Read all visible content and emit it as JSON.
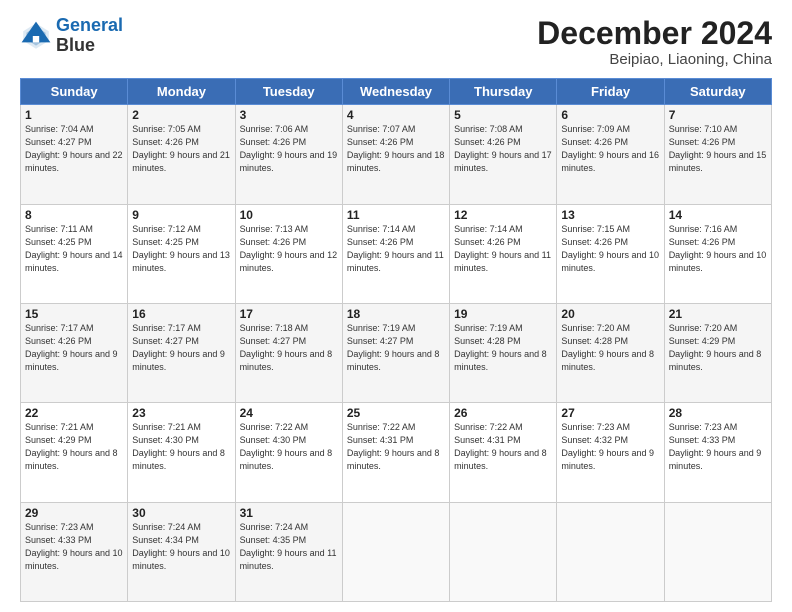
{
  "header": {
    "logo_line1": "General",
    "logo_line2": "Blue",
    "title": "December 2024",
    "subtitle": "Beipiao, Liaoning, China"
  },
  "weekdays": [
    "Sunday",
    "Monday",
    "Tuesday",
    "Wednesday",
    "Thursday",
    "Friday",
    "Saturday"
  ],
  "weeks": [
    [
      {
        "day": "1",
        "sunrise": "7:04 AM",
        "sunset": "4:27 PM",
        "daylight": "9 hours and 22 minutes."
      },
      {
        "day": "2",
        "sunrise": "7:05 AM",
        "sunset": "4:26 PM",
        "daylight": "9 hours and 21 minutes."
      },
      {
        "day": "3",
        "sunrise": "7:06 AM",
        "sunset": "4:26 PM",
        "daylight": "9 hours and 19 minutes."
      },
      {
        "day": "4",
        "sunrise": "7:07 AM",
        "sunset": "4:26 PM",
        "daylight": "9 hours and 18 minutes."
      },
      {
        "day": "5",
        "sunrise": "7:08 AM",
        "sunset": "4:26 PM",
        "daylight": "9 hours and 17 minutes."
      },
      {
        "day": "6",
        "sunrise": "7:09 AM",
        "sunset": "4:26 PM",
        "daylight": "9 hours and 16 minutes."
      },
      {
        "day": "7",
        "sunrise": "7:10 AM",
        "sunset": "4:26 PM",
        "daylight": "9 hours and 15 minutes."
      }
    ],
    [
      {
        "day": "8",
        "sunrise": "7:11 AM",
        "sunset": "4:25 PM",
        "daylight": "9 hours and 14 minutes."
      },
      {
        "day": "9",
        "sunrise": "7:12 AM",
        "sunset": "4:25 PM",
        "daylight": "9 hours and 13 minutes."
      },
      {
        "day": "10",
        "sunrise": "7:13 AM",
        "sunset": "4:26 PM",
        "daylight": "9 hours and 12 minutes."
      },
      {
        "day": "11",
        "sunrise": "7:14 AM",
        "sunset": "4:26 PM",
        "daylight": "9 hours and 11 minutes."
      },
      {
        "day": "12",
        "sunrise": "7:14 AM",
        "sunset": "4:26 PM",
        "daylight": "9 hours and 11 minutes."
      },
      {
        "day": "13",
        "sunrise": "7:15 AM",
        "sunset": "4:26 PM",
        "daylight": "9 hours and 10 minutes."
      },
      {
        "day": "14",
        "sunrise": "7:16 AM",
        "sunset": "4:26 PM",
        "daylight": "9 hours and 10 minutes."
      }
    ],
    [
      {
        "day": "15",
        "sunrise": "7:17 AM",
        "sunset": "4:26 PM",
        "daylight": "9 hours and 9 minutes."
      },
      {
        "day": "16",
        "sunrise": "7:17 AM",
        "sunset": "4:27 PM",
        "daylight": "9 hours and 9 minutes."
      },
      {
        "day": "17",
        "sunrise": "7:18 AM",
        "sunset": "4:27 PM",
        "daylight": "9 hours and 8 minutes."
      },
      {
        "day": "18",
        "sunrise": "7:19 AM",
        "sunset": "4:27 PM",
        "daylight": "9 hours and 8 minutes."
      },
      {
        "day": "19",
        "sunrise": "7:19 AM",
        "sunset": "4:28 PM",
        "daylight": "9 hours and 8 minutes."
      },
      {
        "day": "20",
        "sunrise": "7:20 AM",
        "sunset": "4:28 PM",
        "daylight": "9 hours and 8 minutes."
      },
      {
        "day": "21",
        "sunrise": "7:20 AM",
        "sunset": "4:29 PM",
        "daylight": "9 hours and 8 minutes."
      }
    ],
    [
      {
        "day": "22",
        "sunrise": "7:21 AM",
        "sunset": "4:29 PM",
        "daylight": "9 hours and 8 minutes."
      },
      {
        "day": "23",
        "sunrise": "7:21 AM",
        "sunset": "4:30 PM",
        "daylight": "9 hours and 8 minutes."
      },
      {
        "day": "24",
        "sunrise": "7:22 AM",
        "sunset": "4:30 PM",
        "daylight": "9 hours and 8 minutes."
      },
      {
        "day": "25",
        "sunrise": "7:22 AM",
        "sunset": "4:31 PM",
        "daylight": "9 hours and 8 minutes."
      },
      {
        "day": "26",
        "sunrise": "7:22 AM",
        "sunset": "4:31 PM",
        "daylight": "9 hours and 8 minutes."
      },
      {
        "day": "27",
        "sunrise": "7:23 AM",
        "sunset": "4:32 PM",
        "daylight": "9 hours and 9 minutes."
      },
      {
        "day": "28",
        "sunrise": "7:23 AM",
        "sunset": "4:33 PM",
        "daylight": "9 hours and 9 minutes."
      }
    ],
    [
      {
        "day": "29",
        "sunrise": "7:23 AM",
        "sunset": "4:33 PM",
        "daylight": "9 hours and 10 minutes."
      },
      {
        "day": "30",
        "sunrise": "7:24 AM",
        "sunset": "4:34 PM",
        "daylight": "9 hours and 10 minutes."
      },
      {
        "day": "31",
        "sunrise": "7:24 AM",
        "sunset": "4:35 PM",
        "daylight": "9 hours and 11 minutes."
      },
      null,
      null,
      null,
      null
    ]
  ]
}
